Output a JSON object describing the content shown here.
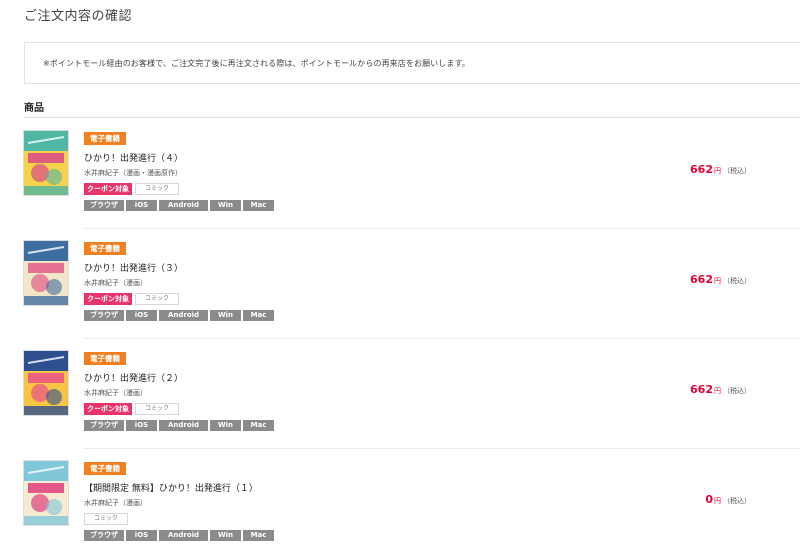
{
  "page": {
    "title": "ご注文内容の確認",
    "notice": "※ポイントモール経由のお客様で、ご注文完了後に再注文される際は、ポイントモールからの再来店をお願いします。",
    "section_heading": "商品"
  },
  "colors": {
    "ebook_badge": "#f28022",
    "coupon_badge": "#e8336b",
    "price": "#e60033",
    "platform_badge": "#8b8b8b"
  },
  "items": [
    {
      "badge": "電子書籍",
      "title": "ひかり！出発進行（４）",
      "author": "水井麻紀子（漫画・漫画原作）",
      "coupon": "クーポン対象",
      "genre": "コミック",
      "platforms": [
        "ブラウザ",
        "iOS",
        "Android",
        "Win",
        "Mac"
      ],
      "price": "662",
      "currency": "円",
      "tax": "（税込）",
      "cover_colors": [
        "#4fb7a3",
        "#d8488a",
        "#f4d24a"
      ]
    },
    {
      "badge": "電子書籍",
      "title": "ひかり！出発進行（３）",
      "author": "水井麻紀子（漫画）",
      "coupon": "クーポン対象",
      "genre": "コミック",
      "platforms": [
        "ブラウザ",
        "iOS",
        "Android",
        "Win",
        "Mac"
      ],
      "price": "662",
      "currency": "円",
      "tax": "（税込）",
      "cover_colors": [
        "#3e6e9f",
        "#e45c8c",
        "#f2e6c8"
      ]
    },
    {
      "badge": "電子書籍",
      "title": "ひかり！出発進行（２）",
      "author": "水井麻紀子（漫画）",
      "coupon": "クーポン対象",
      "genre": "コミック",
      "platforms": [
        "ブラウザ",
        "iOS",
        "Android",
        "Win",
        "Mac"
      ],
      "price": "662",
      "currency": "円",
      "tax": "（税込）",
      "cover_colors": [
        "#2e4f8f",
        "#e9518a",
        "#f6c545"
      ]
    },
    {
      "badge": "電子書籍",
      "title": "【期間限定 無料】ひかり！出発進行（１）",
      "author": "水井麻紀子（漫画）",
      "coupon": "",
      "genre": "コミック",
      "platforms": [
        "ブラウザ",
        "iOS",
        "Android",
        "Win",
        "Mac"
      ],
      "price": "0",
      "currency": "円",
      "tax": "（税込）",
      "cover_colors": [
        "#7fc7d9",
        "#e0407e",
        "#f5ebd0"
      ]
    }
  ]
}
